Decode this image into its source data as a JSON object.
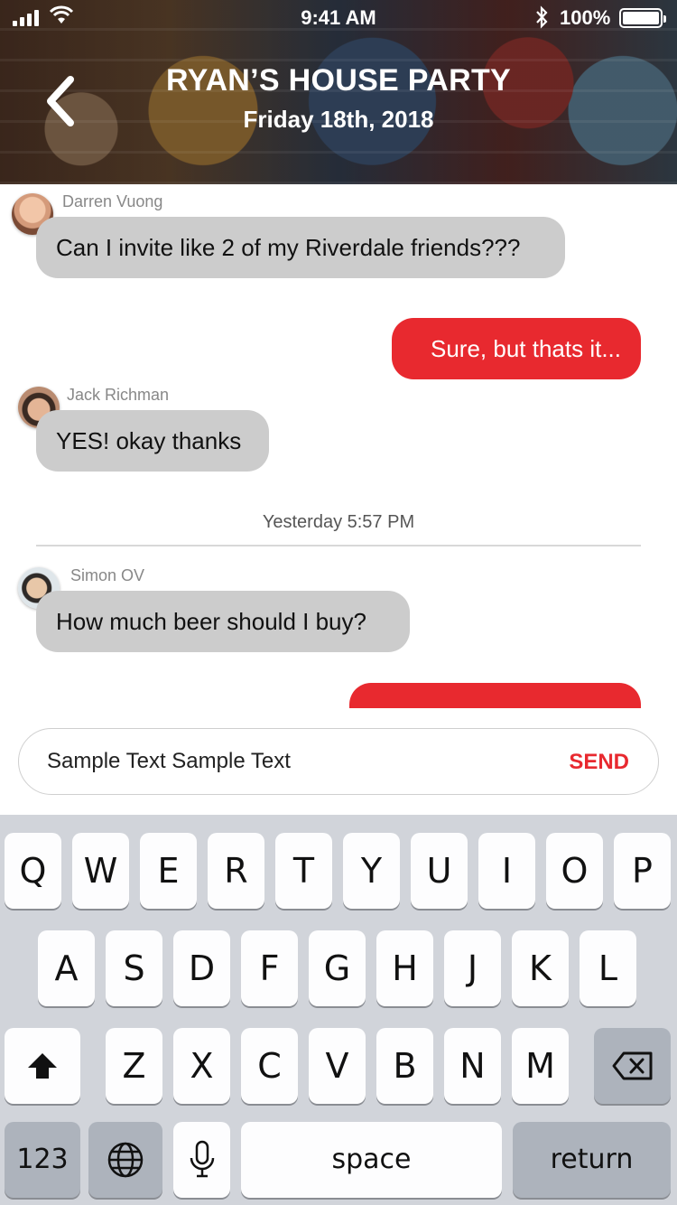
{
  "status_bar": {
    "time": "9:41 AM",
    "battery": "100%",
    "signal_icon": "signal-bars-icon",
    "wifi_icon": "wifi-icon",
    "bluetooth_icon": "bluetooth-icon"
  },
  "header": {
    "title": "RYAN’S HOUSE PARTY",
    "subtitle": "Friday 18th, 2018",
    "back_icon": "chevron-left-icon"
  },
  "messages": [
    {
      "sender": "Darren Vuong",
      "text": "Can I invite like 2 of my Riverdale friends???",
      "direction": "incoming"
    },
    {
      "sender": "",
      "text": "Sure, but thats it...",
      "direction": "outgoing"
    },
    {
      "sender": "Jack Richman",
      "text": "YES! okay thanks",
      "direction": "incoming"
    },
    {
      "sender": "Simon OV",
      "text": "How much beer should I buy?",
      "direction": "incoming"
    },
    {
      "sender": "",
      "text": "",
      "direction": "outgoing"
    }
  ],
  "timestamp": "Yesterday 5:57 PM",
  "composer": {
    "value": "Sample Text Sample Text",
    "send_label": "SEND"
  },
  "keyboard": {
    "row1": [
      "Q",
      "W",
      "E",
      "R",
      "T",
      "Y",
      "U",
      "I",
      "O",
      "P"
    ],
    "row2": [
      "A",
      "S",
      "D",
      "F",
      "G",
      "H",
      "J",
      "K",
      "L"
    ],
    "row3": [
      "Z",
      "X",
      "C",
      "V",
      "B",
      "N",
      "M"
    ],
    "numbers_label": "123",
    "space_label": "space",
    "return_label": "return",
    "shift_icon": "shift-icon",
    "backspace_icon": "backspace-icon",
    "globe_icon": "globe-icon",
    "mic_icon": "microphone-icon"
  },
  "colors": {
    "accent": "#e8292f",
    "incoming_bubble": "#cccccc",
    "keyboard_bg": "#d1d4da"
  }
}
